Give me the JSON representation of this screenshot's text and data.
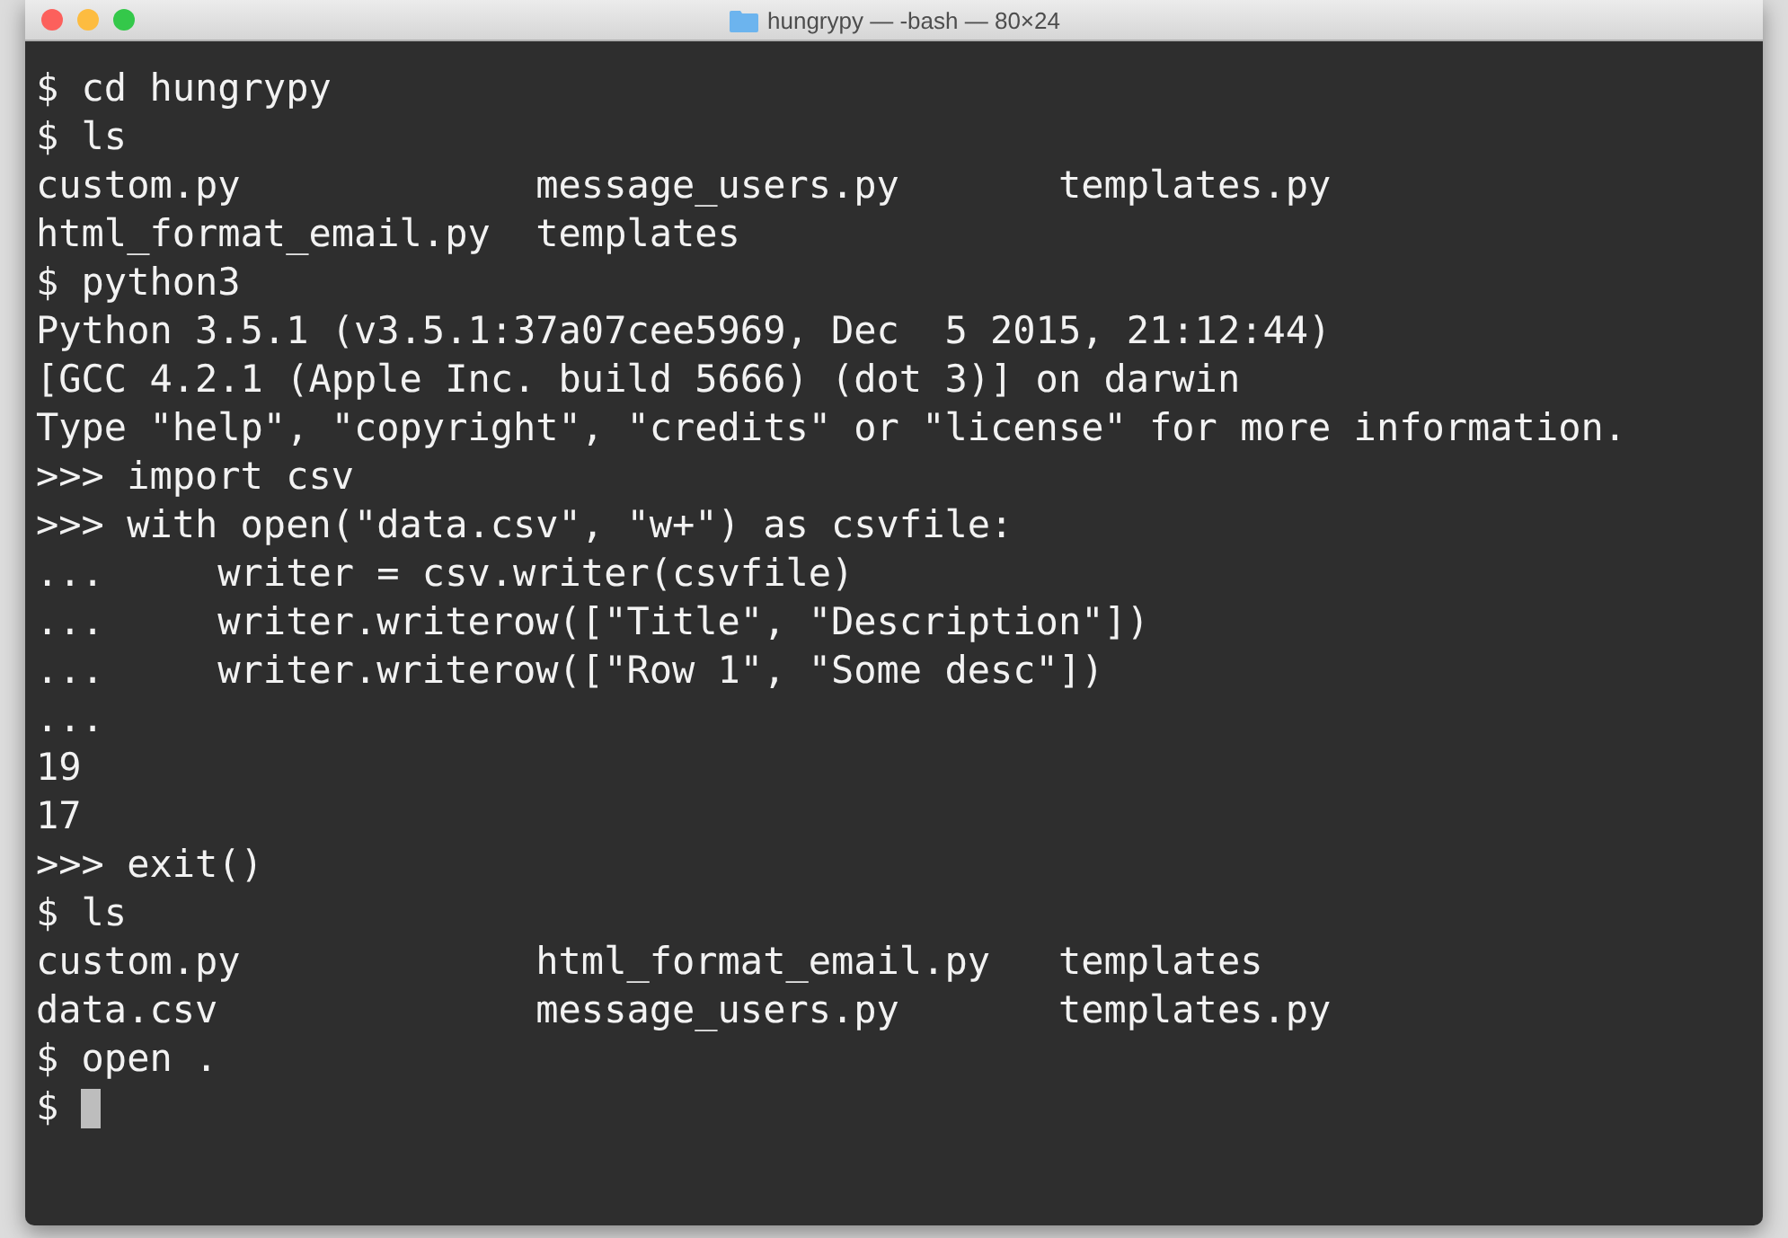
{
  "window": {
    "title": "hungrypy — -bash — 80×24"
  },
  "terminal": {
    "lines": [
      {
        "kind": "text",
        "text": "$ cd hungrypy"
      },
      {
        "kind": "text",
        "text": "$ ls"
      },
      {
        "kind": "text",
        "text": "custom.py             message_users.py       templates.py"
      },
      {
        "kind": "text",
        "text": "html_format_email.py  templates"
      },
      {
        "kind": "text",
        "text": "$ python3"
      },
      {
        "kind": "text",
        "text": "Python 3.5.1 (v3.5.1:37a07cee5969, Dec  5 2015, 21:12:44)"
      },
      {
        "kind": "text",
        "text": "[GCC 4.2.1 (Apple Inc. build 5666) (dot 3)] on darwin"
      },
      {
        "kind": "text",
        "text": "Type \"help\", \"copyright\", \"credits\" or \"license\" for more information."
      },
      {
        "kind": "text",
        "text": ">>> import csv"
      },
      {
        "kind": "text",
        "text": ">>> with open(\"data.csv\", \"w+\") as csvfile:"
      },
      {
        "kind": "text",
        "text": "...     writer = csv.writer(csvfile)"
      },
      {
        "kind": "text",
        "text": "...     writer.writerow([\"Title\", \"Description\"])"
      },
      {
        "kind": "text",
        "text": "...     writer.writerow([\"Row 1\", \"Some desc\"])"
      },
      {
        "kind": "text",
        "text": "..."
      },
      {
        "kind": "text",
        "text": "19"
      },
      {
        "kind": "text",
        "text": "17"
      },
      {
        "kind": "text",
        "text": ">>> exit()"
      },
      {
        "kind": "text",
        "text": "$ ls"
      },
      {
        "kind": "text",
        "text": "custom.py             html_format_email.py   templates"
      },
      {
        "kind": "text",
        "text": "data.csv              message_users.py       templates.py"
      },
      {
        "kind": "text",
        "text": "$ open ."
      },
      {
        "kind": "cursor",
        "text": "$ "
      }
    ]
  }
}
